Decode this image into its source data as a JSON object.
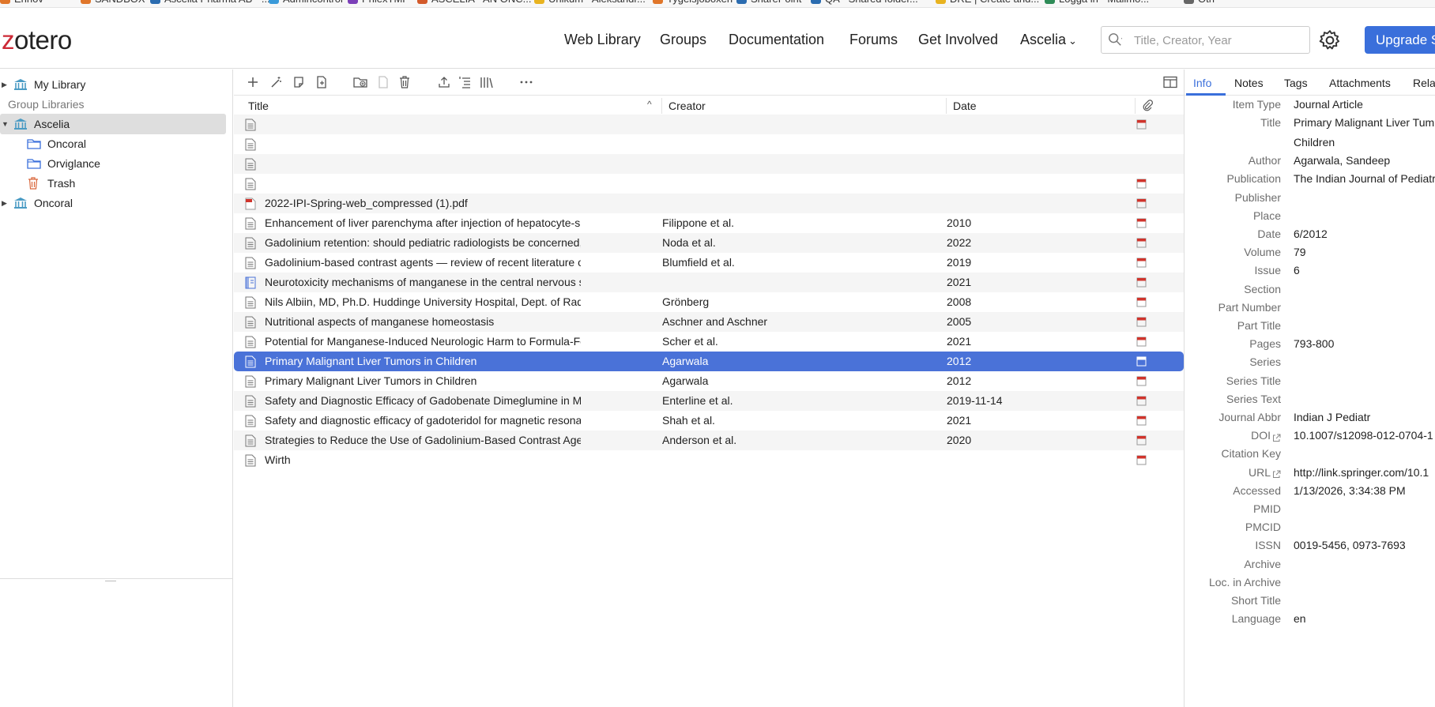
{
  "bookmarks": [
    {
      "label": "Ennov",
      "color": "#e0762a"
    },
    {
      "label": "SANDBOX",
      "color": "#e0762a"
    },
    {
      "label": "Ascelia Pharma AB - ...",
      "color": "#2b6cb0"
    },
    {
      "label": "Admincontrol",
      "color": "#3a9ad9"
    },
    {
      "label": "PhlexTMF",
      "color": "#7b3fb8"
    },
    {
      "label": "ASCELIA - AN ONC...",
      "color": "#d35a2a"
    },
    {
      "label": "Unikum - Aleksandr...",
      "color": "#e8b320"
    },
    {
      "label": "Tygelsjöboxen",
      "color": "#e0762a"
    },
    {
      "label": "SharePoint",
      "color": "#2b6cb0"
    },
    {
      "label": "QA - Shared folder...",
      "color": "#2b6cb0"
    },
    {
      "label": "DRE | Create and...",
      "color": "#e8b320"
    },
    {
      "label": "Logga in - Mailmo...",
      "color": "#2e8b57"
    },
    {
      "label": "Oth",
      "color": "#666666"
    }
  ],
  "header": {
    "logo_z": "z",
    "logo_rest": "otero",
    "nav": [
      "Web Library",
      "Groups",
      "Documentation",
      "Forums",
      "Get Involved"
    ],
    "user_menu": "Ascelia",
    "search_placeholder": "Title, Creator, Year",
    "upgrade_label": "Upgrade S"
  },
  "sidebar": {
    "items": [
      {
        "label": "My Library",
        "type": "library",
        "twisty": "▶"
      },
      {
        "label": "Group Libraries",
        "type": "header"
      },
      {
        "label": "Ascelia",
        "type": "library",
        "twisty": "▼",
        "selected": true
      },
      {
        "label": "Oncoral",
        "type": "folder"
      },
      {
        "label": "Orviglance",
        "type": "folder"
      },
      {
        "label": "Trash",
        "type": "trash"
      },
      {
        "label": "Oncoral",
        "type": "library",
        "twisty": "▶"
      }
    ]
  },
  "items_table": {
    "columns": {
      "title": "Title",
      "creator": "Creator",
      "date": "Date",
      "sort_indicator": "^"
    },
    "rows": [
      {
        "title": "",
        "creator": "",
        "date": "",
        "icon": "doc",
        "pdf": true
      },
      {
        "title": "",
        "creator": "",
        "date": "",
        "icon": "doc",
        "pdf": false
      },
      {
        "title": "",
        "creator": "",
        "date": "",
        "icon": "doc",
        "pdf": false
      },
      {
        "title": "",
        "creator": "",
        "date": "",
        "icon": "doc",
        "pdf": true
      },
      {
        "title": "2022-IPI-Spring-web_compressed (1).pdf",
        "creator": "",
        "date": "",
        "icon": "pdf",
        "pdf": true
      },
      {
        "title": "Enhancement of liver parenchyma after injection of hepatocyte-specific ...",
        "creator": "Filippone et al.",
        "date": "2010",
        "icon": "doc",
        "pdf": true
      },
      {
        "title": "Gadolinium retention: should pediatric radiologists be concerned, and h...",
        "creator": "Noda et al.",
        "date": "2022",
        "icon": "doc",
        "pdf": true
      },
      {
        "title": "Gadolinium-based contrast agents — review of recent literature on mag...",
        "creator": "Blumfield et al.",
        "date": "2019",
        "icon": "doc",
        "pdf": true
      },
      {
        "title": "Neurotoxicity mechanisms of manganese in the central nervous system",
        "creator": "",
        "date": "2021",
        "icon": "book",
        "pdf": true
      },
      {
        "title": "Nils Albiin, MD, Ph.D. Huddinge University Hospital, Dept. of Radiology ...",
        "creator": "Grönberg",
        "date": "2008",
        "icon": "doc",
        "pdf": true
      },
      {
        "title": "Nutritional aspects of manganese homeostasis",
        "creator": "Aschner and Aschner",
        "date": "2005",
        "icon": "doc",
        "pdf": true
      },
      {
        "title": "Potential for Manganese-Induced Neurologic Harm to Formula-Fed Infa...",
        "creator": "Scher et al.",
        "date": "2021",
        "icon": "doc",
        "pdf": true
      },
      {
        "title": "Primary Malignant Liver Tumors in Children",
        "creator": "Agarwala",
        "date": "2012",
        "icon": "doc",
        "pdf": true,
        "selected": true
      },
      {
        "title": "Primary Malignant Liver Tumors in Children",
        "creator": "Agarwala",
        "date": "2012",
        "icon": "doc",
        "pdf": true
      },
      {
        "title": "Safety and Diagnostic Efficacy of Gadobenate Dimeglumine in MRI of th...",
        "creator": "Enterline et al.",
        "date": "2019-11-14",
        "icon": "doc",
        "pdf": true
      },
      {
        "title": "Safety and diagnostic efficacy of gadoteridol for magnetic resonance im...",
        "creator": "Shah et al.",
        "date": "2021",
        "icon": "doc",
        "pdf": true
      },
      {
        "title": "Strategies to Reduce the Use of Gadolinium-Based Contrast Agents for ...",
        "creator": "Anderson et al.",
        "date": "2020",
        "icon": "doc",
        "pdf": true
      },
      {
        "title": "Wirth",
        "creator": "",
        "date": "",
        "icon": "doc",
        "pdf": true
      }
    ]
  },
  "item_pane": {
    "tabs": [
      "Info",
      "Notes",
      "Tags",
      "Attachments",
      "Rela"
    ],
    "fields": [
      {
        "label": "Item Type",
        "value": "Journal Article"
      },
      {
        "label": "Title",
        "value": "Primary Malignant Liver Tum Children",
        "wrap": true
      },
      {
        "label": "Author",
        "value": "Agarwala, Sandeep"
      },
      {
        "label": "Publication",
        "value": "The Indian Journal of Pediatr"
      },
      {
        "label": "Publisher",
        "value": ""
      },
      {
        "label": "Place",
        "value": ""
      },
      {
        "label": "Date",
        "value": "6/2012"
      },
      {
        "label": "Volume",
        "value": "79"
      },
      {
        "label": "Issue",
        "value": "6"
      },
      {
        "label": "Section",
        "value": ""
      },
      {
        "label": "Part Number",
        "value": ""
      },
      {
        "label": "Part Title",
        "value": ""
      },
      {
        "label": "Pages",
        "value": "793-800"
      },
      {
        "label": "Series",
        "value": ""
      },
      {
        "label": "Series Title",
        "value": ""
      },
      {
        "label": "Series Text",
        "value": ""
      },
      {
        "label": "Journal Abbr",
        "value": "Indian J Pediatr"
      },
      {
        "label": "DOI",
        "value": "10.1007/s12098-012-0704-1",
        "link": true
      },
      {
        "label": "Citation Key",
        "value": ""
      },
      {
        "label": "URL",
        "value": "http://link.springer.com/10.1",
        "link": true
      },
      {
        "label": "Accessed",
        "value": "1/13/2026, 3:34:38 PM"
      },
      {
        "label": "PMID",
        "value": ""
      },
      {
        "label": "PMCID",
        "value": ""
      },
      {
        "label": "ISSN",
        "value": "0019-5456, 0973-7693"
      },
      {
        "label": "Archive",
        "value": ""
      },
      {
        "label": "Loc. in Archive",
        "value": ""
      },
      {
        "label": "Short Title",
        "value": ""
      },
      {
        "label": "Language",
        "value": "en"
      }
    ]
  },
  "colors": {
    "accent": "#3a6fdb",
    "selected_row": "#4a72d8",
    "logo_z": "#cc2936",
    "library_icon": "#4a9bc4",
    "folder_icon": "#3a6fdb",
    "trash_icon": "#d9663a",
    "pdf_icon": "#d0342c"
  }
}
